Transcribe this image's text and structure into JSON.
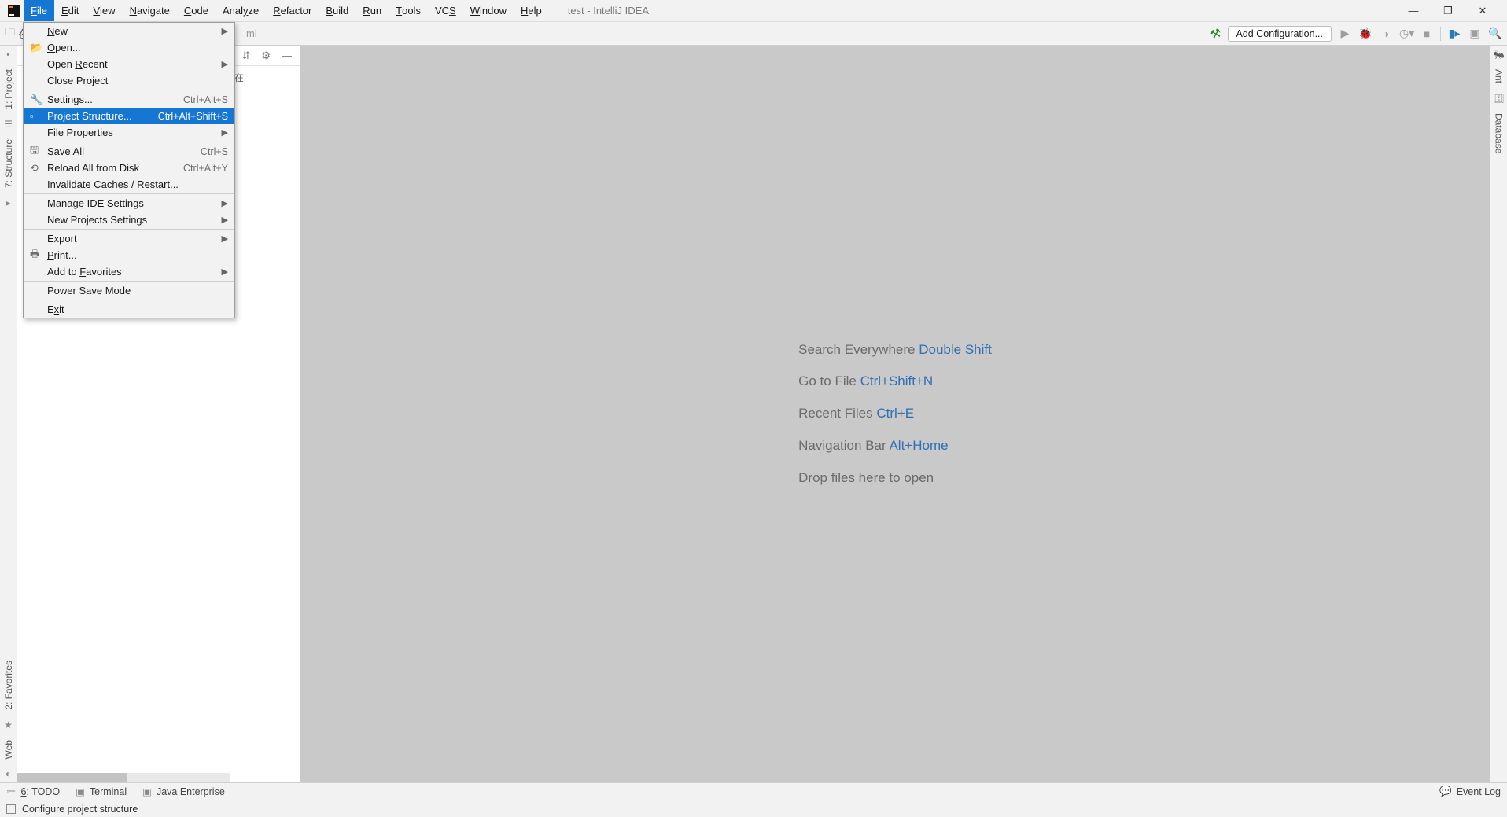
{
  "window": {
    "title": "test - IntelliJ IDEA"
  },
  "menubar": [
    "File",
    "Edit",
    "View",
    "Navigate",
    "Code",
    "Analyze",
    "Refactor",
    "Build",
    "Run",
    "Tools",
    "VCS",
    "Window",
    "Help"
  ],
  "menubar_mnemonic_index": [
    0,
    0,
    0,
    0,
    0,
    4,
    0,
    0,
    0,
    0,
    2,
    0,
    0
  ],
  "menubar_active": "File",
  "toolbar": {
    "breadcrumb_left": "在线",
    "breadcrumb_file_tail": "ml",
    "add_configuration": "Add Configuration..."
  },
  "file_menu": {
    "items": [
      {
        "icon": "",
        "label": "New",
        "shortcut": "",
        "submenu": true,
        "mn": 0
      },
      {
        "icon": "📂",
        "label": "Open...",
        "shortcut": "",
        "submenu": false,
        "mn": 0
      },
      {
        "icon": "",
        "label": "Open Recent",
        "shortcut": "",
        "submenu": true,
        "mn": 5
      },
      {
        "icon": "",
        "label": "Close Project",
        "shortcut": "",
        "submenu": false
      },
      {
        "sep": true
      },
      {
        "icon": "🔧",
        "label": "Settings...",
        "shortcut": "Ctrl+Alt+S",
        "submenu": false
      },
      {
        "icon": "▫",
        "label": "Project Structure...",
        "shortcut": "Ctrl+Alt+Shift+S",
        "submenu": false,
        "selected": true
      },
      {
        "icon": "",
        "label": "File Properties",
        "shortcut": "",
        "submenu": true
      },
      {
        "sep": true
      },
      {
        "icon": "🖫",
        "label": "Save All",
        "shortcut": "Ctrl+S",
        "submenu": false,
        "mn": 0
      },
      {
        "icon": "⟲",
        "label": "Reload All from Disk",
        "shortcut": "Ctrl+Alt+Y",
        "submenu": false
      },
      {
        "icon": "",
        "label": "Invalidate Caches / Restart...",
        "shortcut": "",
        "submenu": false
      },
      {
        "sep": true
      },
      {
        "icon": "",
        "label": "Manage IDE Settings",
        "shortcut": "",
        "submenu": true
      },
      {
        "icon": "",
        "label": "New Projects Settings",
        "shortcut": "",
        "submenu": true
      },
      {
        "sep": true
      },
      {
        "icon": "",
        "label": "Export",
        "shortcut": "",
        "submenu": true
      },
      {
        "icon": "🖶",
        "label": "Print...",
        "shortcut": "",
        "submenu": false,
        "mn": 0
      },
      {
        "icon": "",
        "label": "Add to Favorites",
        "shortcut": "",
        "submenu": true,
        "mn": 7
      },
      {
        "sep": true
      },
      {
        "icon": "",
        "label": "Power Save Mode",
        "shortcut": "",
        "submenu": false
      },
      {
        "sep": true
      },
      {
        "icon": "",
        "label": "Exit",
        "shortcut": "",
        "submenu": false,
        "mn": 1
      }
    ]
  },
  "left_gutter": [
    {
      "label": "1: Project"
    },
    {
      "label": "7: Structure"
    },
    {
      "label": "2: Favorites"
    },
    {
      "label": "Web"
    }
  ],
  "right_gutter": [
    {
      "label": "Ant"
    },
    {
      "label": "Database"
    }
  ],
  "project_panel": {
    "path_tail": "Web后端\\test\\在"
  },
  "editor_hints": [
    {
      "text": "Search Everywhere",
      "shortcut": "Double Shift"
    },
    {
      "text": "Go to File",
      "shortcut": "Ctrl+Shift+N"
    },
    {
      "text": "Recent Files",
      "shortcut": "Ctrl+E"
    },
    {
      "text": "Navigation Bar",
      "shortcut": "Alt+Home"
    },
    {
      "text": "Drop files here to open",
      "shortcut": ""
    }
  ],
  "bottom_tabs": [
    {
      "icon": "≔",
      "label": "6: TODO",
      "mn": 0
    },
    {
      "icon": "▣",
      "label": "Terminal"
    },
    {
      "icon": "▣",
      "label": "Java Enterprise"
    }
  ],
  "event_log": "Event Log",
  "statusbar": {
    "text": "Configure project structure"
  }
}
